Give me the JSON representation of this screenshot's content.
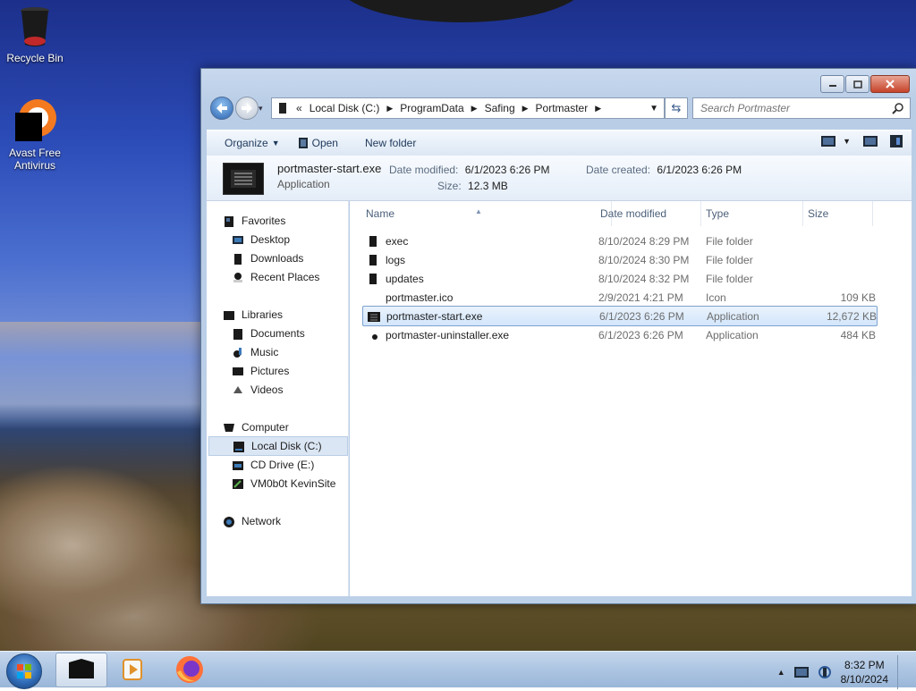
{
  "desktop": {
    "icons": [
      {
        "label": "Recycle Bin",
        "icon": "recycle-bin-icon"
      },
      {
        "label": "Avast Free Antivirus",
        "icon": "avast-icon"
      }
    ]
  },
  "window": {
    "address": {
      "prefix": "«",
      "segments": [
        "Local Disk (C:)",
        "ProgramData",
        "Safing",
        "Portmaster"
      ]
    },
    "search_placeholder": "Search Portmaster",
    "toolbar": {
      "organize": "Organize",
      "open": "Open",
      "new_folder": "New folder"
    },
    "preview": {
      "name": "portmaster-start.exe",
      "type": "Application",
      "date_modified_label": "Date modified:",
      "date_modified": "6/1/2023 6:26 PM",
      "date_created_label": "Date created:",
      "date_created": "6/1/2023 6:26 PM",
      "size_label": "Size:",
      "size": "12.3 MB"
    },
    "nav": {
      "favorites": "Favorites",
      "desktop": "Desktop",
      "downloads": "Downloads",
      "recent": "Recent Places",
      "libraries": "Libraries",
      "documents": "Documents",
      "music": "Music",
      "pictures": "Pictures",
      "videos": "Videos",
      "computer": "Computer",
      "local_disk": "Local Disk (C:)",
      "cd_drive": "CD Drive (E:)",
      "vm": "VM0b0t KevinSite",
      "network": "Network"
    },
    "columns": {
      "name": "Name",
      "date": "Date modified",
      "type": "Type",
      "size": "Size"
    },
    "files": [
      {
        "name": "exec",
        "date": "8/10/2024 8:29 PM",
        "type": "File folder",
        "size": ""
      },
      {
        "name": "logs",
        "date": "8/10/2024 8:30 PM",
        "type": "File folder",
        "size": ""
      },
      {
        "name": "updates",
        "date": "8/10/2024 8:32 PM",
        "type": "File folder",
        "size": ""
      },
      {
        "name": "portmaster.ico",
        "date": "2/9/2021 4:21 PM",
        "type": "Icon",
        "size": "109 KB"
      },
      {
        "name": "portmaster-start.exe",
        "date": "6/1/2023 6:26 PM",
        "type": "Application",
        "size": "12,672 KB"
      },
      {
        "name": "portmaster-uninstaller.exe",
        "date": "6/1/2023 6:26 PM",
        "type": "Application",
        "size": "484 KB"
      }
    ]
  },
  "taskbar": {
    "time": "8:32 PM",
    "date": "8/10/2024"
  }
}
